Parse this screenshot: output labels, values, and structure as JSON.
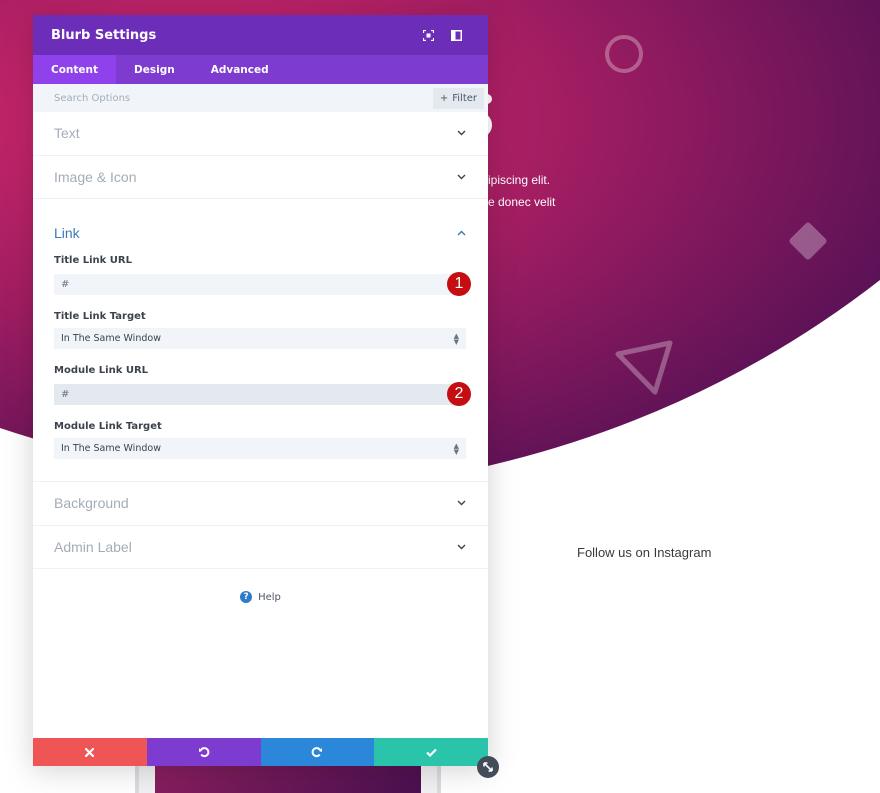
{
  "background": {
    "hero_text_line1": "ipiscing elit.",
    "hero_text_line2": "e donec velit",
    "follow_text": "Follow us on Instagram",
    "gradient_colors": [
      "#d2286a",
      "#4a0f54"
    ]
  },
  "modal": {
    "title": "Blurb Settings",
    "header_icons": [
      "fullscreen-icon",
      "sidebar-toggle-icon"
    ],
    "tabs": [
      {
        "label": "Content",
        "active": true
      },
      {
        "label": "Design",
        "active": false
      },
      {
        "label": "Advanced",
        "active": false
      }
    ],
    "search": {
      "placeholder": "Search Options",
      "value": ""
    },
    "filter_label": "Filter",
    "sections": {
      "text": "Text",
      "image_icon": "Image & Icon",
      "link": "Link",
      "background": "Background",
      "admin_label": "Admin Label"
    },
    "link_fields": {
      "title_link_url": {
        "label": "Title Link URL",
        "value": "#",
        "badge": "1"
      },
      "title_link_target": {
        "label": "Title Link Target",
        "value": "In The Same Window"
      },
      "module_link_url": {
        "label": "Module Link URL",
        "value": "#",
        "badge": "2"
      },
      "module_link_target": {
        "label": "Module Link Target",
        "value": "In The Same Window"
      }
    },
    "help_label": "Help",
    "footer": {
      "cancel_color": "#ef5555",
      "undo_color": "#7d3bd0",
      "redo_color": "#2b87da",
      "save_color": "#29c4a9"
    }
  }
}
